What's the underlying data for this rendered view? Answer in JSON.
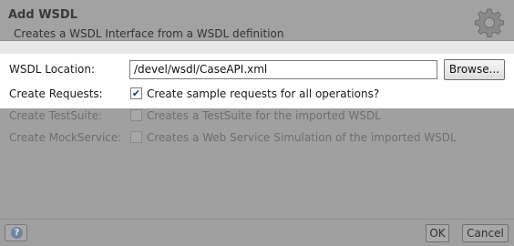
{
  "header": {
    "title": "Add WSDL",
    "subtitle": "Creates a WSDL Interface from a WSDL definition",
    "icon": "gear-icon"
  },
  "form": {
    "wsdl_location": {
      "label": "WSDL Location:",
      "value": "/devel/wsdl/CaseAPI.xml",
      "browse_label": "Browse..."
    },
    "create_requests": {
      "label": "Create Requests:",
      "checked": true,
      "checkbox_label": "Create sample requests for all operations?"
    },
    "create_testsuite": {
      "label": "Create TestSuite:",
      "checked": false,
      "checkbox_label": "Creates a TestSuite for the imported WSDL"
    },
    "create_mockservice": {
      "label": "Create MockService:",
      "checked": false,
      "checkbox_label": "Creates a Web Service Simulation of the imported WSDL"
    }
  },
  "footer": {
    "help_icon": "help-icon",
    "ok_label": "OK",
    "cancel_label": "Cancel"
  }
}
